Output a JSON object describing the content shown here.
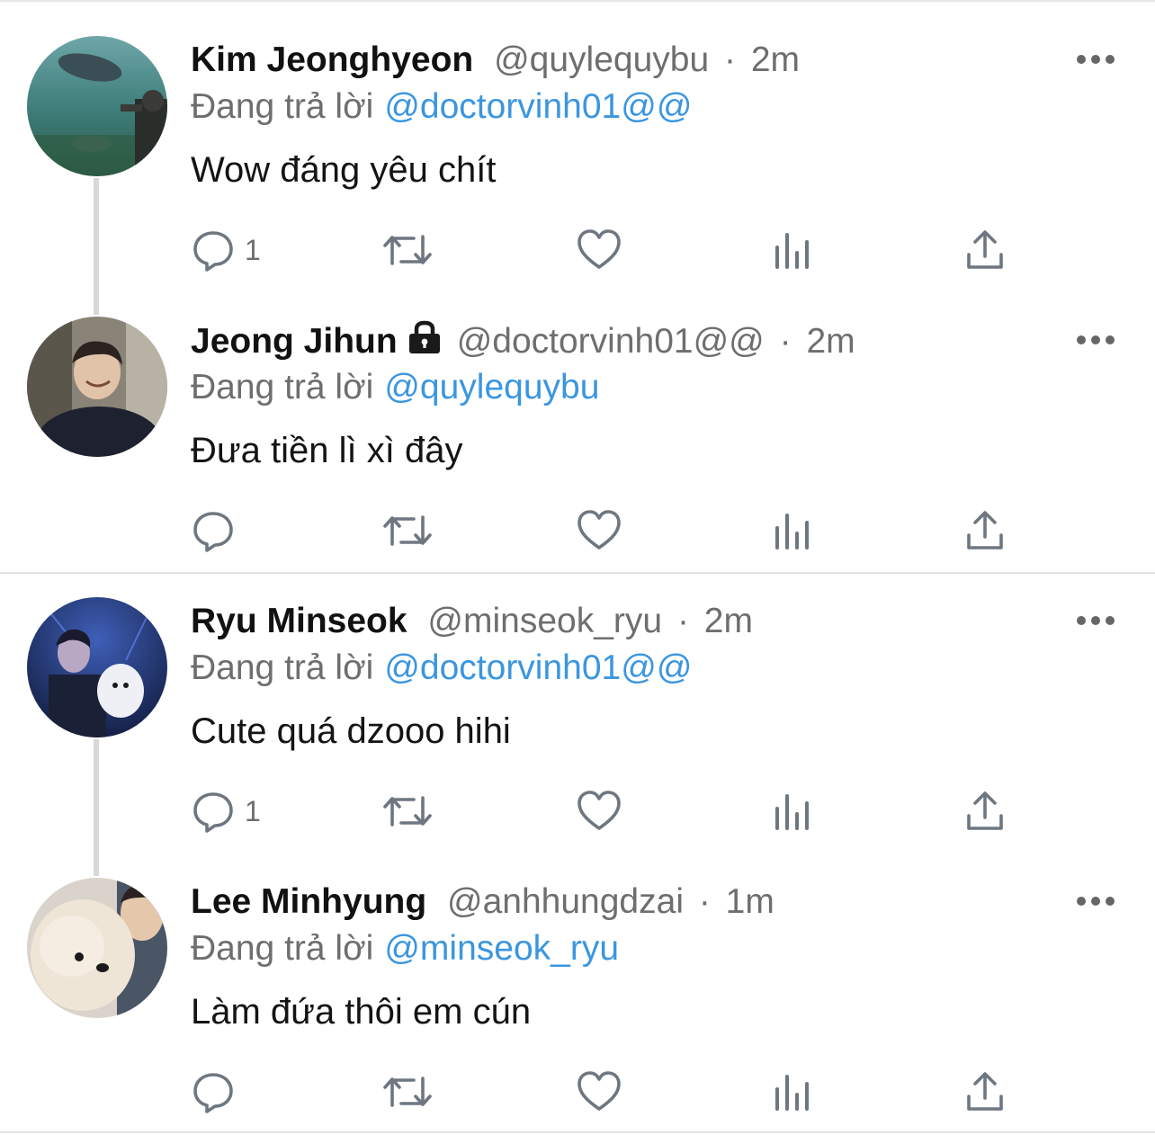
{
  "threads": [
    {
      "tweets": [
        {
          "name": "Kim Jeonghyeon",
          "locked": false,
          "handle": "@quylequybu",
          "dot": "·",
          "time": "2m",
          "reply_prefix": "Đang trả lời",
          "reply_to": "@doctorvinh01@@",
          "text": "Wow đáng yêu chít",
          "reply_count": "1",
          "avatar_theme": "aquarium"
        },
        {
          "name": "Jeong Jihun",
          "locked": true,
          "handle": "@doctorvinh01@@",
          "dot": "·",
          "time": "2m",
          "reply_prefix": "Đang trả lời",
          "reply_to": "@quylequybu",
          "text": "Đưa tiền lì xì đây",
          "reply_count": "",
          "avatar_theme": "laughing-man"
        }
      ]
    },
    {
      "tweets": [
        {
          "name": "Ryu Minseok",
          "locked": false,
          "handle": "@minseok_ryu",
          "dot": "·",
          "time": "2m",
          "reply_prefix": "Đang trả lời",
          "reply_to": "@doctorvinh01@@",
          "text": "Cute quá dzooo hihi",
          "reply_count": "1",
          "avatar_theme": "blue-night-dog"
        },
        {
          "name": "Lee Minhyung",
          "locked": false,
          "handle": "@anhhungdzai",
          "dot": "·",
          "time": "1m",
          "reply_prefix": "Đang trả lời",
          "reply_to": "@minseok_ryu",
          "text": "Làm đứa thôi em cún",
          "reply_count": "",
          "avatar_theme": "fluffy-dog"
        }
      ]
    }
  ],
  "icons": {
    "reply": "comment-bubble-icon",
    "retweet": "retweet-icon",
    "like": "heart-icon",
    "views": "analytics-bars-icon",
    "share": "share-upload-icon",
    "more": "more-dots-icon",
    "lock": "lock-icon"
  },
  "colors": {
    "mention": "#3b96e0",
    "secondary_text": "#6e6e6e",
    "icon": "#6e7780",
    "thread_line": "#d8d8d8"
  }
}
